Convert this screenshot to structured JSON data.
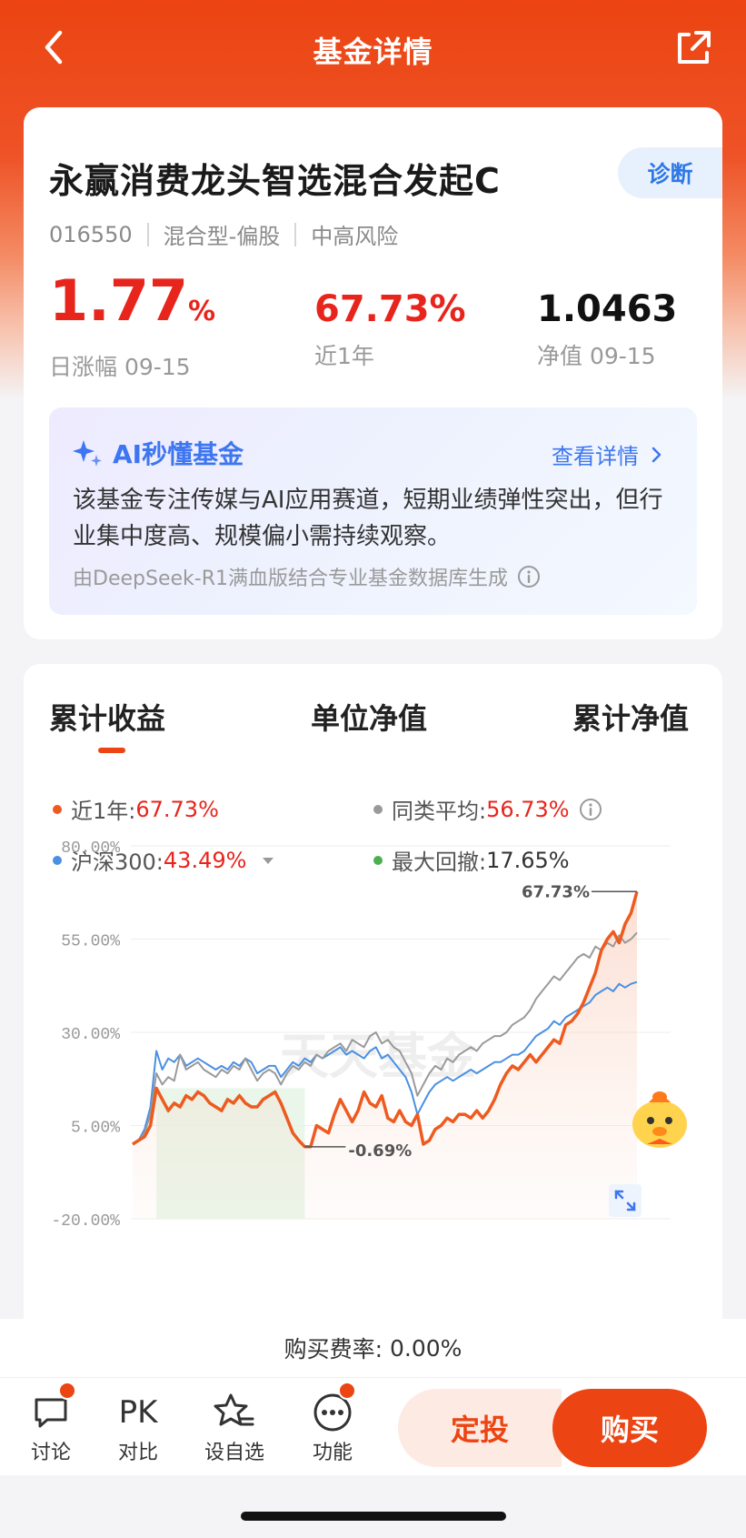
{
  "nav": {
    "title": "基金详情"
  },
  "fund": {
    "name": "永赢消费龙头智选混合发起C",
    "diagnose_label": "诊断",
    "code": "016550",
    "type": "混合型-偏股",
    "risk": "中高风险",
    "daily_change": "1.77",
    "daily_change_unit": "%",
    "daily_change_label": "日涨幅 09-15",
    "year_return": "67.73%",
    "year_return_label": "近1年",
    "nav_value": "1.0463",
    "nav_label": "净值 09-15"
  },
  "ai": {
    "title": "AI秒懂基金",
    "more": "查看详情",
    "text": "该基金专注传媒与AI应用赛道，短期业绩弹性突出，但行业集中度高、规模偏小需持续观察。",
    "footer": "由DeepSeek-R1满血版结合专业基金数据库生成"
  },
  "tabs": [
    "累计收益",
    "单位净值",
    "累计净值"
  ],
  "legend": {
    "fund_label": "近1年:",
    "fund_value": "67.73%",
    "peer_label": "同类平均:",
    "peer_value": "56.73%",
    "index_label": "沪深300:",
    "index_value": "43.49%",
    "drawdown_label": "最大回撤:",
    "drawdown_value": "17.65%"
  },
  "colors": {
    "fund": "#ee5a1f",
    "peer": "#9a9a9a",
    "index": "#4a90e2",
    "drawdown": "#4caf50",
    "accent": "#ec4412"
  },
  "watermark": "天天基金",
  "chart_data": {
    "type": "line",
    "ylim": [
      -20,
      80
    ],
    "yticks": [
      "80.00%",
      "55.00%",
      "30.00%",
      "5.00%",
      "-20.00%"
    ],
    "annotations": {
      "max": "67.73%",
      "min": "-0.69%"
    },
    "series": [
      {
        "name": "近1年",
        "key": "fund",
        "values": [
          0,
          1,
          2,
          5,
          15,
          12,
          9,
          11,
          10,
          13,
          12,
          14,
          13,
          11,
          10,
          9,
          12,
          11,
          13,
          11,
          10,
          10,
          12,
          13,
          14,
          11,
          7,
          3,
          1,
          -0.69,
          -0.69,
          5,
          4,
          3,
          8,
          12,
          9,
          6,
          9,
          14,
          11,
          10,
          13,
          7,
          6,
          9,
          6,
          5,
          8,
          0,
          1,
          4,
          5,
          7,
          6,
          8,
          8,
          7,
          9,
          7,
          9,
          12,
          16,
          19,
          21,
          20,
          22,
          24,
          22,
          24,
          26,
          28,
          27,
          32,
          33,
          35,
          38,
          42,
          46,
          52,
          55,
          57,
          54,
          59,
          62,
          67.73
        ]
      },
      {
        "name": "同类平均",
        "key": "peer",
        "values": [
          0,
          1,
          3,
          8,
          19,
          16,
          18,
          17,
          24,
          20,
          21,
          22,
          20,
          19,
          18,
          20,
          19,
          21,
          20,
          23,
          20,
          17,
          19,
          20,
          19,
          16,
          19,
          21,
          20,
          22,
          21,
          24,
          23,
          25,
          26,
          27,
          25,
          28,
          27,
          26,
          29,
          30,
          27,
          28,
          26,
          25,
          22,
          19,
          13,
          16,
          19,
          21,
          20,
          23,
          22,
          24,
          25,
          26,
          25,
          27,
          28,
          29,
          29,
          30,
          32,
          33,
          34,
          36,
          39,
          41,
          43,
          45,
          44,
          46,
          48,
          50,
          51,
          50,
          53,
          52,
          54,
          53,
          56,
          54,
          55,
          56.73
        ]
      },
      {
        "name": "沪深300",
        "key": "index",
        "values": [
          0,
          1,
          4,
          10,
          25,
          20,
          23,
          22,
          24,
          21,
          22,
          23,
          22,
          21,
          20,
          21,
          20,
          22,
          21,
          23,
          22,
          19,
          20,
          21,
          21,
          18,
          20,
          22,
          21,
          23,
          22,
          24,
          23,
          24,
          25,
          26,
          24,
          25,
          24,
          23,
          25,
          26,
          23,
          24,
          22,
          20,
          18,
          14,
          8,
          11,
          14,
          16,
          17,
          18,
          17,
          18,
          19,
          20,
          19,
          20,
          21,
          22,
          22,
          23,
          24,
          24,
          25,
          27,
          29,
          30,
          31,
          33,
          32,
          34,
          35,
          36,
          37,
          38,
          40,
          41,
          42,
          41,
          43,
          42,
          43,
          43.49
        ]
      }
    ]
  },
  "fee": {
    "label": "购买费率:",
    "value": "0.00%"
  },
  "bottom": {
    "discuss": "讨论",
    "pk_icon": "PK",
    "compare": "对比",
    "watchlist": "设自选",
    "functions": "功能",
    "auto_invest": "定投",
    "buy": "购买"
  }
}
